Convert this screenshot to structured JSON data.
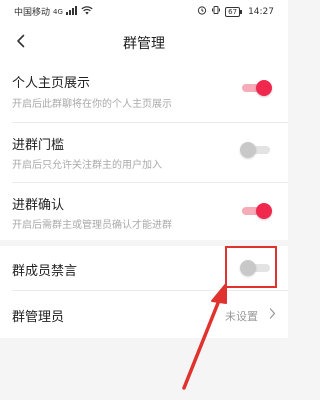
{
  "status_bar": {
    "carrier": "中国移动",
    "signal": "4G",
    "battery": "67",
    "time": "14:27"
  },
  "header": {
    "title": "群管理"
  },
  "settings": [
    {
      "title": "个人主页展示",
      "desc": "开启后此群聊将在你的个人主页展示",
      "toggle": "on"
    },
    {
      "title": "进群门槛",
      "desc": "开启后只允许关注群主的用户加入",
      "toggle": "off"
    },
    {
      "title": "进群确认",
      "desc": "开启后需群主或管理员确认才能进群",
      "toggle": "on"
    },
    {
      "title": "群成员禁言",
      "toggle": "off"
    },
    {
      "title": "群管理员",
      "value": "未设置"
    }
  ],
  "colors": {
    "accent": "#f0284e",
    "annotation": "#e0322f"
  }
}
